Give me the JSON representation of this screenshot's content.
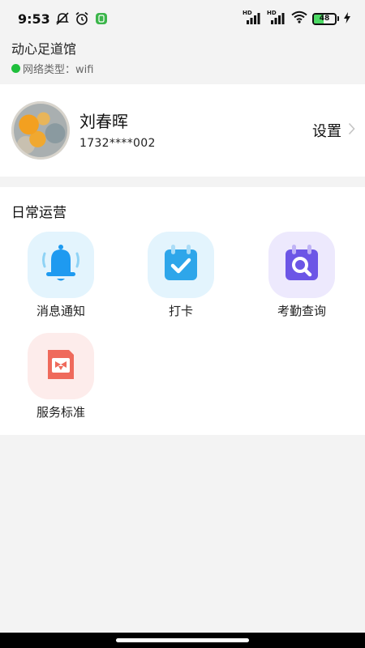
{
  "status_bar": {
    "time": "9:53",
    "battery_level": "48",
    "icons": [
      "mute-icon",
      "alarm-icon",
      "app-notification-icon",
      "hd-signal-icon",
      "hd-signal-icon",
      "wifi-icon",
      "battery-icon",
      "charging-icon"
    ]
  },
  "venue": {
    "name": "动心足道馆",
    "network_label": "网络类型：wifi",
    "network_status_color": "#1fbf3c"
  },
  "profile": {
    "name": "刘春晖",
    "phone": "1732****002",
    "settings_label": "设置"
  },
  "daily_ops": {
    "title": "日常运营",
    "items": [
      {
        "label": "消息通知",
        "icon": "bell-icon",
        "tile_color": "#e3f4fd",
        "icon_color": "#1e9af0"
      },
      {
        "label": "打卡",
        "icon": "calendar-check-icon",
        "tile_color": "#e3f4fd",
        "icon_color": "#2ea6ea"
      },
      {
        "label": "考勤查询",
        "icon": "calendar-search-icon",
        "tile_color": "#ede9fd",
        "icon_color": "#6c56e6"
      },
      {
        "label": "服务标准",
        "icon": "bowtie-card-icon",
        "tile_color": "#fdeceb",
        "icon_color": "#ef6a5c"
      }
    ]
  }
}
